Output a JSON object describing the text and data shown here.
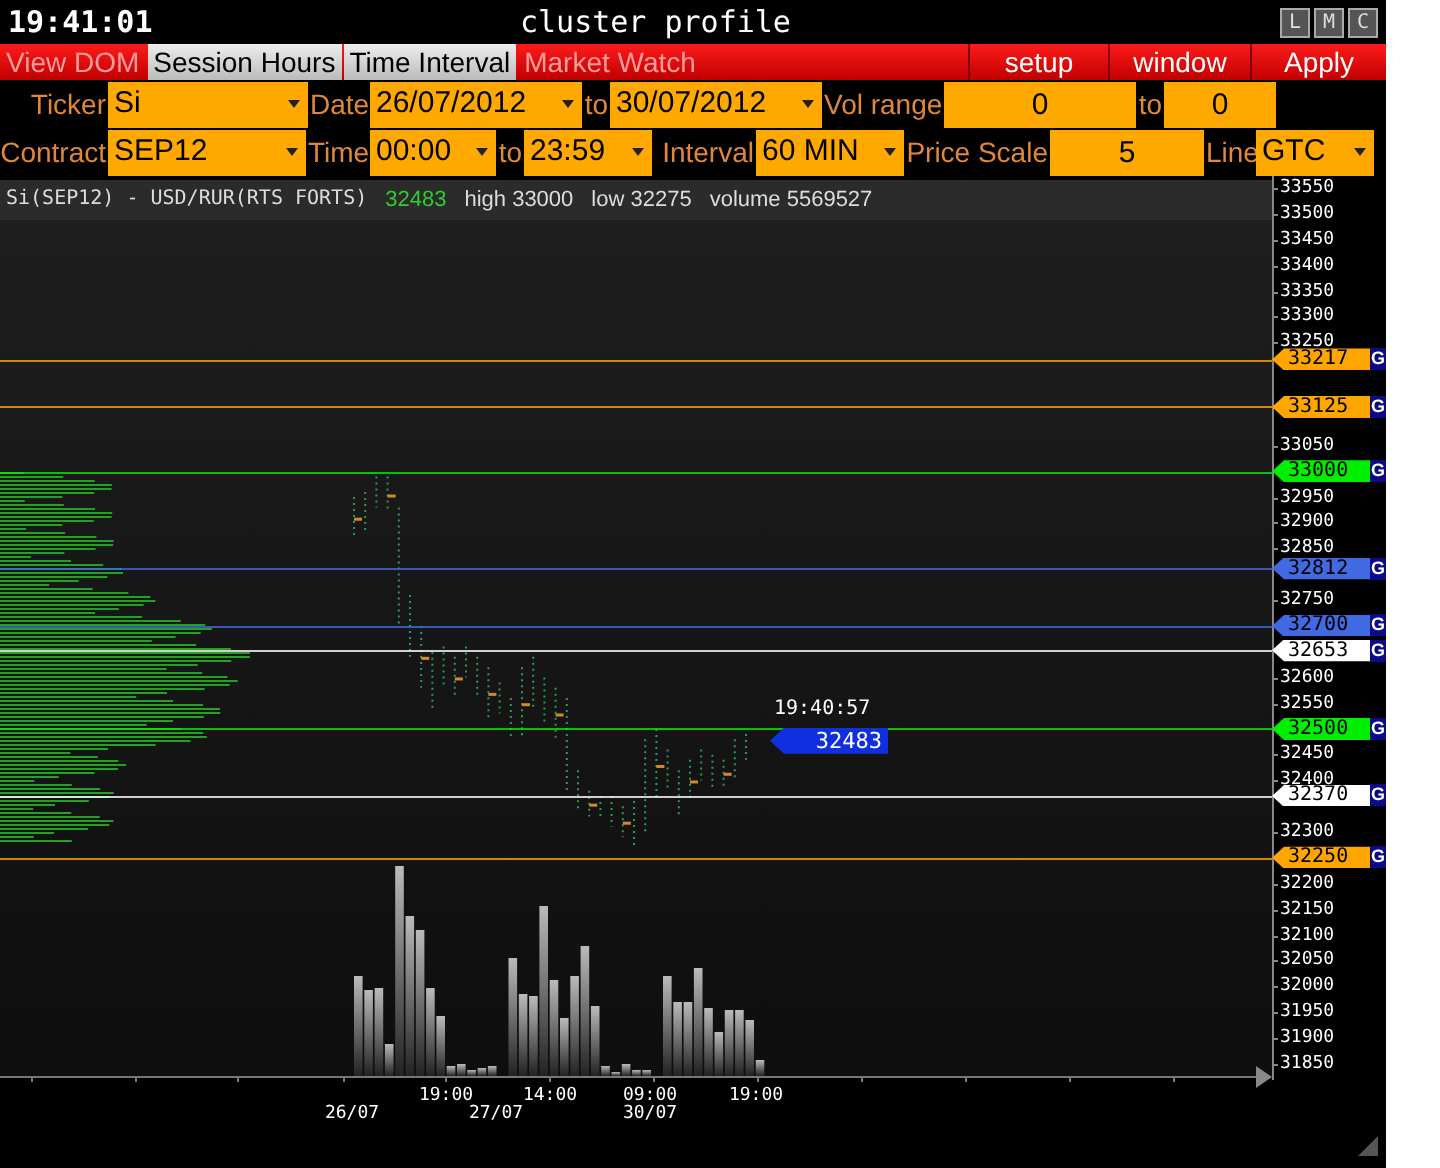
{
  "window": {
    "clock": "19:41:01",
    "title": "cluster profile",
    "buttons": [
      "L",
      "M",
      "C"
    ]
  },
  "menu": {
    "tabs": [
      {
        "label": "View DOM",
        "selected": false
      },
      {
        "label": "Session Hours",
        "selected": true
      },
      {
        "label": "Time Interval",
        "selected": true
      },
      {
        "label": "Market Watch",
        "selected": false
      }
    ],
    "actions": [
      "setup",
      "window",
      "Apply"
    ]
  },
  "form_rows": [
    [
      {
        "kind": "label",
        "text": "Ticker"
      },
      {
        "kind": "select",
        "value": "Si"
      },
      {
        "kind": "label",
        "text": "Date"
      },
      {
        "kind": "select",
        "value": "26/07/2012"
      },
      {
        "kind": "label",
        "text": "to"
      },
      {
        "kind": "select",
        "value": "30/07/2012"
      },
      {
        "kind": "label",
        "text": "Vol range"
      },
      {
        "kind": "input",
        "value": "0"
      },
      {
        "kind": "label",
        "text": "to"
      },
      {
        "kind": "input",
        "value": "0"
      }
    ],
    [
      {
        "kind": "label",
        "text": "Contract"
      },
      {
        "kind": "select",
        "value": "SEP12"
      },
      {
        "kind": "label",
        "text": "Time"
      },
      {
        "kind": "select",
        "value": "00:00"
      },
      {
        "kind": "label",
        "text": "to"
      },
      {
        "kind": "select",
        "value": "23:59"
      },
      {
        "kind": "label",
        "text": "Interval"
      },
      {
        "kind": "select",
        "value": "60 MIN"
      },
      {
        "kind": "label",
        "text": "Price Scale"
      },
      {
        "kind": "input",
        "value": "5"
      },
      {
        "kind": "label",
        "text": "Line"
      },
      {
        "kind": "select",
        "value": "GTC"
      }
    ]
  ],
  "info": {
    "symbol": "Si(SEP12) - USD/RUR(RTS FORTS)",
    "last": "32483",
    "high": "high 33000",
    "low": "low 32275",
    "volume": "volume 5569527"
  },
  "price_axis": {
    "ticks": [
      "33550",
      "33500",
      "33450",
      "33400",
      "33350",
      "33300",
      "33250",
      "33050",
      "32950",
      "32900",
      "32850",
      "32750",
      "32600",
      "32550",
      "32450",
      "32400",
      "32300",
      "32200",
      "32150",
      "32100",
      "32050",
      "32000",
      "31950",
      "31900",
      "31850"
    ]
  },
  "levels": [
    {
      "price": "33217",
      "color": "#ffa500",
      "flag": "G"
    },
    {
      "price": "33125",
      "color": "#ffa500",
      "flag": "G"
    },
    {
      "price": "33000",
      "color": "#00ee00",
      "flag": "G"
    },
    {
      "price": "32812",
      "color": "#4169e1",
      "flag": "G"
    },
    {
      "price": "32700",
      "color": "#4169e1",
      "flag": "G"
    },
    {
      "price": "32653",
      "color": "#ffffff",
      "flag": "G"
    },
    {
      "price": "32500",
      "color": "#00ee00",
      "flag": "G"
    },
    {
      "price": "32370",
      "color": "#ffffff",
      "flag": "G"
    },
    {
      "price": "32250",
      "color": "#ffa500",
      "flag": "G"
    }
  ],
  "last_price": {
    "time": "19:40:57",
    "price": "32483"
  },
  "time_axis": {
    "times": [
      "19:00",
      "14:00",
      "09:00",
      "19:00"
    ],
    "dates": [
      "26/07",
      "27/07",
      "30/07"
    ]
  }
}
